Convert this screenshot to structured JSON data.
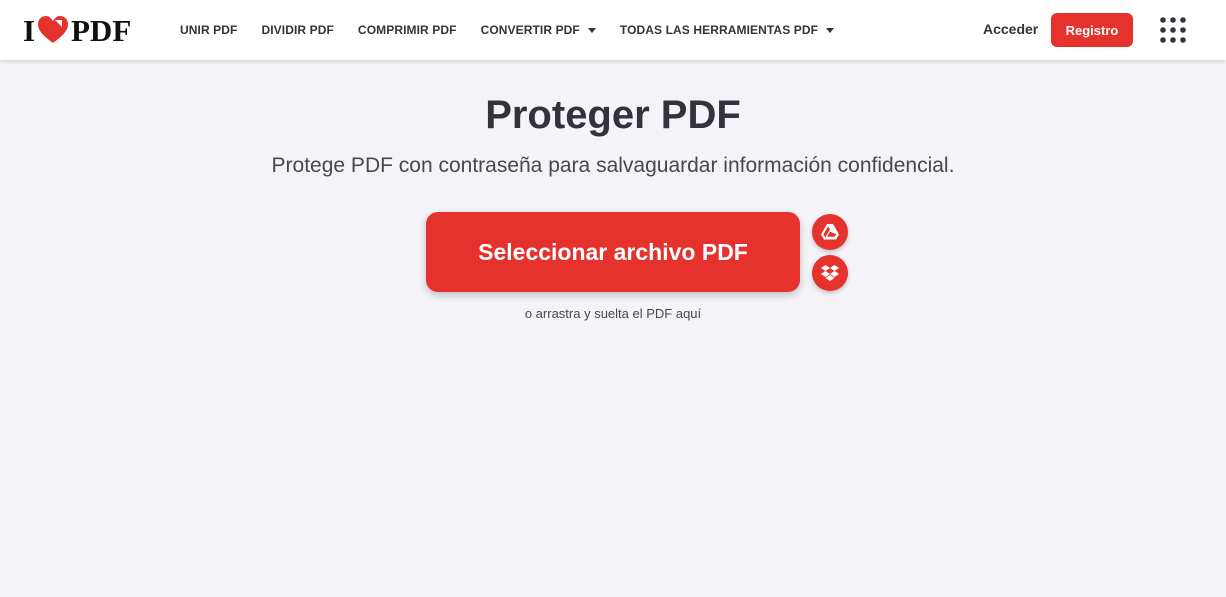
{
  "brand": {
    "logo_letter": "I",
    "logo_word": "PDF",
    "heart_color": "#e5322d",
    "accent": "#e5322d"
  },
  "nav": {
    "items": [
      {
        "label": "UNIR PDF",
        "dropdown": false
      },
      {
        "label": "DIVIDIR PDF",
        "dropdown": false
      },
      {
        "label": "COMPRIMIR PDF",
        "dropdown": false
      },
      {
        "label": "CONVERTIR PDF",
        "dropdown": true
      },
      {
        "label": "TODAS LAS HERRAMIENTAS PDF",
        "dropdown": true
      }
    ]
  },
  "auth": {
    "login_label": "Acceder",
    "register_label": "Registro"
  },
  "icons": {
    "apps": "grid-dots-icon",
    "gdrive": "google-drive-icon",
    "dropbox": "dropbox-icon"
  },
  "main": {
    "title": "Proteger PDF",
    "subtitle": "Protege PDF con contraseña para salvaguardar información confidencial.",
    "select_button_label": "Seleccionar archivo PDF",
    "drop_hint": "o arrastra y suelta el PDF aquí"
  }
}
